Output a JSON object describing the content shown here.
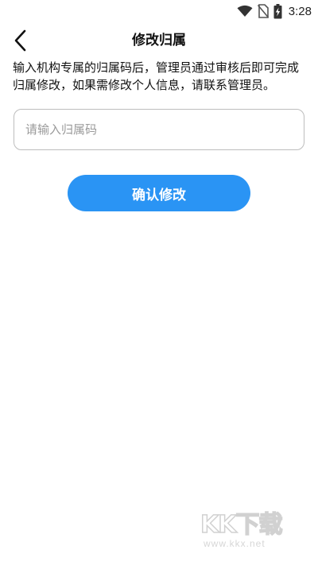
{
  "status_bar": {
    "time": "3:28",
    "icons": [
      "wifi-icon",
      "no-sim-icon",
      "battery-charging-icon"
    ]
  },
  "header": {
    "title": "修改归属",
    "back_icon": "chevron-left-icon"
  },
  "description": "输入机构专属的归属码后，管理员通过审核后即可完成归属修改，如果需修改个人信息，请联系管理员。",
  "form": {
    "code_input": {
      "placeholder": "请输入归属码",
      "value": ""
    },
    "confirm_label": "确认修改"
  },
  "watermark": {
    "logo": "KK下载",
    "url": "www.kkx.net"
  },
  "colors": {
    "accent": "#2a94f4",
    "input_border": "#bdbdbd",
    "placeholder": "#9a9a9a",
    "caret": "#1a8a7a"
  }
}
